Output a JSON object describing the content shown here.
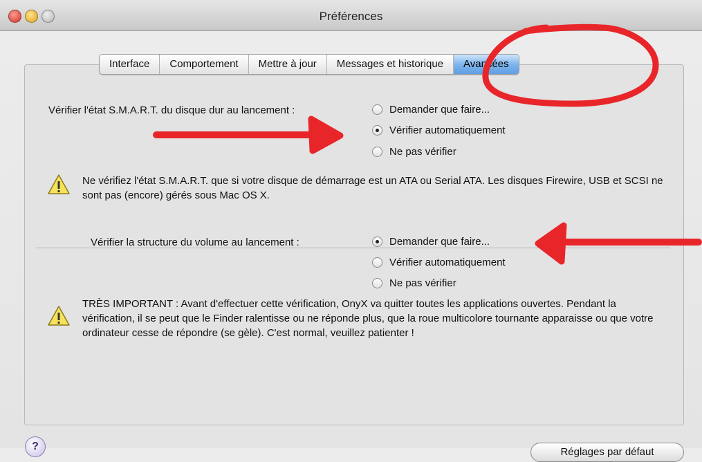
{
  "window": {
    "title": "Préférences"
  },
  "tabs": [
    {
      "label": "Interface"
    },
    {
      "label": "Comportement"
    },
    {
      "label": "Mettre à jour"
    },
    {
      "label": "Messages et historique"
    },
    {
      "label": "Avancées",
      "active": true
    }
  ],
  "smart": {
    "label": "Vérifier l'état S.M.A.R.T. du disque dur au lancement :",
    "options": [
      "Demander que faire...",
      "Vérifier automatiquement",
      "Ne pas vérifier"
    ],
    "selected": "Vérifier automatiquement",
    "warning": "Ne vérifiez l'état S.M.A.R.T. que si votre disque de démarrage est un ATA ou Serial ATA. Les disques Firewire, USB et SCSI ne sont pas (encore) gérés sous Mac OS X."
  },
  "volume": {
    "label": "Vérifier la structure du volume au lancement :",
    "options": [
      "Demander que faire...",
      "Vérifier automatiquement",
      "Ne pas vérifier"
    ],
    "selected": "Demander que faire...",
    "warning": "TRÈS IMPORTANT : Avant d'effectuer cette vérification, OnyX va quitter toutes les applications ouvertes. Pendant la vérification, il se peut que le Finder ralentisse ou ne réponde plus, que la roue multicolore tournante apparaisse ou que votre ordinateur cesse de répondre (se gèle). C'est normal, veuillez patienter !"
  },
  "help": {
    "label": "?"
  },
  "defaults_button": {
    "label": "Réglages par défaut"
  },
  "annotation_color": "#e8262a"
}
